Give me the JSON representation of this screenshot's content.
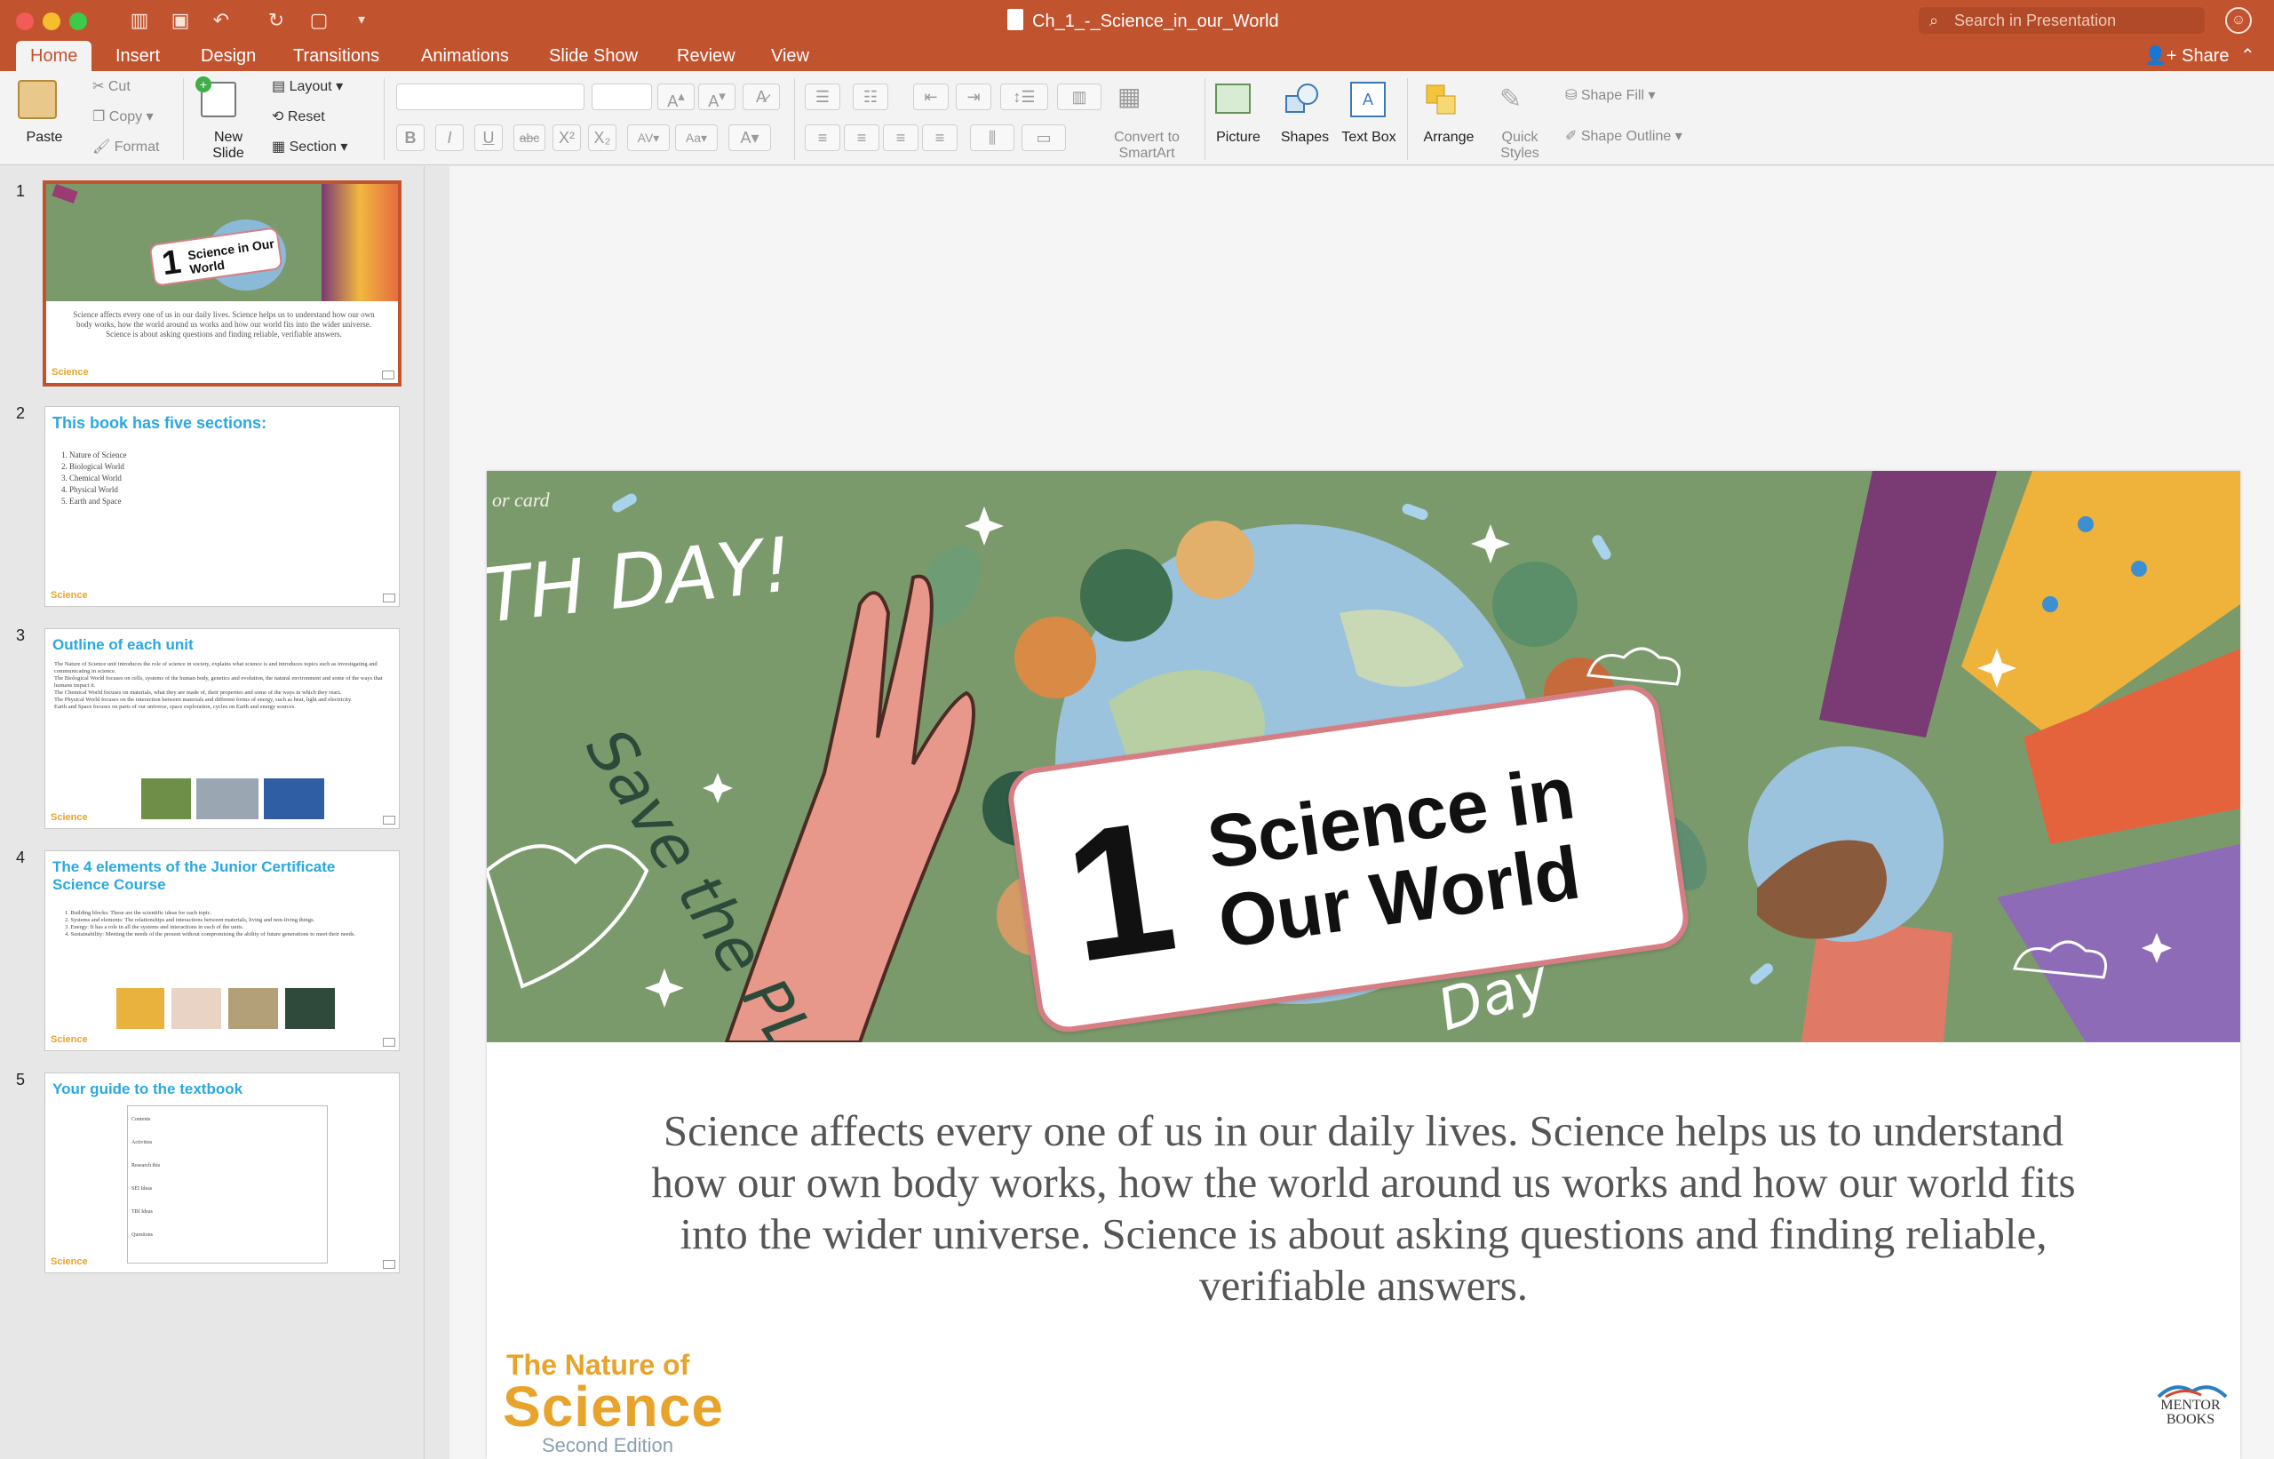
{
  "window": {
    "title": "Ch_1_-_Science_in_our_World",
    "search_placeholder": "Search in Presentation"
  },
  "tabs": [
    "Home",
    "Insert",
    "Design",
    "Transitions",
    "Animations",
    "Slide Show",
    "Review",
    "View"
  ],
  "share_label": "Share",
  "ribbon": {
    "paste": "Paste",
    "cut": "Cut",
    "copy": "Copy",
    "format": "Format",
    "new_slide": "New Slide",
    "layout": "Layout",
    "reset": "Reset",
    "section": "Section",
    "convert_smartart": "Convert to SmartArt",
    "picture": "Picture",
    "shapes": "Shapes",
    "text_box": "Text Box",
    "arrange": "Arrange",
    "quick_styles": "Quick Styles",
    "shape_fill": "Shape Fill",
    "shape_outline": "Shape Outline"
  },
  "thumbnails": [
    {
      "num": "1",
      "title": "",
      "card_title": "Science in Our World",
      "card_number": "1",
      "body": "Science affects every one of us in our daily lives. Science helps us to understand how our own body works, how the world around us works and how our world fits into the wider universe. Science is about asking questions and finding reliable, verifiable answers."
    },
    {
      "num": "2",
      "title": "This book has five sections:",
      "items": [
        "1. Nature of Science",
        "2. Biological World",
        "3. Chemical World",
        "4. Physical World",
        "5. Earth and Space"
      ]
    },
    {
      "num": "3",
      "title": "Outline of each unit",
      "items": [
        "The Nature of Science unit introduces the role of science in society, explains what science is and introduces topics such as investigating and communicating in science.",
        "The Biological World focuses on cells, systems of the human body, genetics and evolution, the natural environment and some of the ways that humans impact it.",
        "The Chemical World focuses on materials, what they are made of, their properties and some of the ways in which they react.",
        "The Physical World focuses on the interaction between materials and different forms of energy, such as heat, light and electricity.",
        "Earth and Space focuses on parts of our universe, space exploration, cycles on Earth and energy sources."
      ]
    },
    {
      "num": "4",
      "title": "The 4 elements of the Junior Certificate Science Course",
      "items": [
        "1. Building blocks: These are the scientific ideas for each topic.",
        "2. Systems and elements: The relationships and interactions between materials, living and non-living things.",
        "3. Energy: It has a role in all the systems and interactions in each of the units.",
        "4. Sustainability: Meeting the needs of the present without compromising the ability of future generations to meet their needs."
      ]
    },
    {
      "num": "5",
      "title": "Your guide to the textbook",
      "items": [
        "Contents",
        "Activities",
        "Research this",
        "SEI Ideas",
        "TBI Ideas",
        "Questions"
      ]
    }
  ],
  "slide": {
    "art_script": "or card",
    "art_words": [
      "TH DAY!",
      "Save the PLANET",
      "Day"
    ],
    "card_number": "1",
    "card_line1": "Science in",
    "card_line2": "Our World",
    "body": "Science affects every one of us in our daily lives. Science helps us to understand how our own body works, how the world around us works and how our world fits into the wider universe. Science is about asking questions and finding reliable, verifiable answers.",
    "logo_title": "The Nature of",
    "logo_main": "Science",
    "logo_sub": "Second Edition",
    "publisher": "MENTOR BOOKS"
  },
  "colors": {
    "accent": "#c2532f",
    "thumb_title": "#2aa8df",
    "logo": "#e8a32b",
    "art_bg": "#7b9a6c"
  }
}
